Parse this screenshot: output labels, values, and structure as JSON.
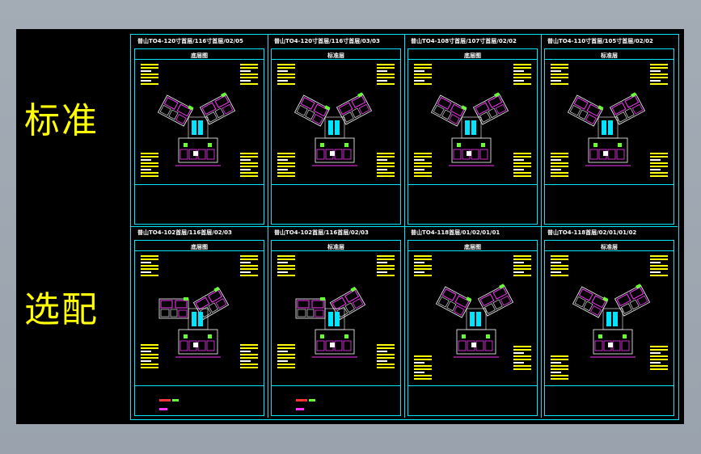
{
  "row_labels": {
    "standard": "标准",
    "optional": "选配"
  },
  "sheets": [
    {
      "title": "普山TO4-120寸首层/116寸首层/02/05",
      "subtitle": "底层图"
    },
    {
      "title": "普山TO4-120寸首层/116寸首层/03/03",
      "subtitle": "标准层"
    },
    {
      "title": "普山TO4-108寸首层/107寸首层/02/02",
      "subtitle": "底层图"
    },
    {
      "title": "普山TO4-110寸首层/105寸首层/02/02",
      "subtitle": "标准层"
    },
    {
      "title": "普山TO4-102首层/116首层/02/03",
      "subtitle": "底层图"
    },
    {
      "title": "普山TO4-102首层/116首层/02/03",
      "subtitle": "标准层"
    },
    {
      "title": "普山TO4-118首层/01/02/01/01",
      "subtitle": "底层图"
    },
    {
      "title": "普山TO4-118首层/02/01/01/02",
      "subtitle": "标准层"
    }
  ],
  "colors": {
    "frame": "#00e5ff",
    "text": "#ffff00",
    "wall": "#ff33ff",
    "room_fill": "#00e5ff",
    "accent": "#66ff33"
  },
  "icons": {
    "floor_plan": "cad-floor-plan-drawing"
  }
}
